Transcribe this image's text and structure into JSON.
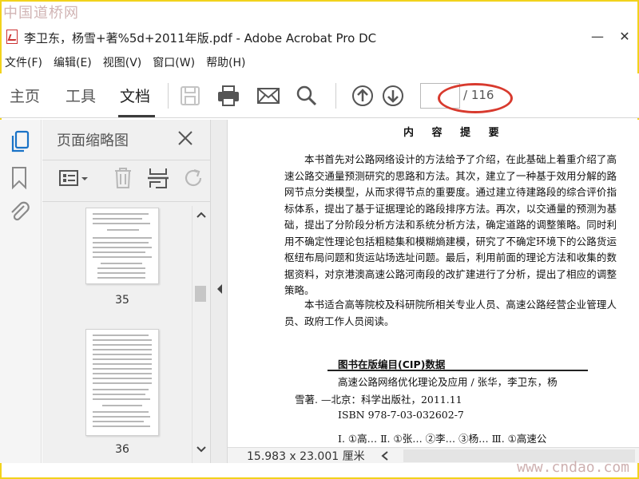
{
  "watermarks": {
    "top": "中国道桥网",
    "bottom": "www.cndao.com"
  },
  "window": {
    "title": "李卫东，杨雪+著%5d+2011年版.pdf - Adobe Acrobat Pro DC",
    "minimize": "—",
    "close": "✕"
  },
  "menu": [
    "文件(F)",
    "编辑(E)",
    "视图(V)",
    "窗口(W)",
    "帮助(H)"
  ],
  "toolbar": {
    "tabs": [
      "主页",
      "工具",
      "文档"
    ],
    "active_tab": "文档",
    "page_current": "",
    "page_total": "/ 116",
    "icons": [
      "save-icon",
      "print-icon",
      "email-icon",
      "search-icon",
      "page-up-icon",
      "page-down-icon"
    ]
  },
  "rail_icons": [
    "page-thumbnails-icon",
    "bookmark-icon",
    "attachment-icon"
  ],
  "thumbnail_panel": {
    "title": "页面缩略图",
    "pages": [
      {
        "number": "35"
      },
      {
        "number": "36"
      }
    ]
  },
  "document": {
    "heading": "内 容 提 要",
    "paragraphs": [
      "本书首先对公路网络设计的方法给予了介绍，在此基础上着重介绍了高速公路交通量预测研究的思路和方法。其次，建立了一种基于效用分解的路网节点分类模型，从而求得节点的重要度。通过建立待建路段的综合评价指标体系，提出了基于证据理论的路段排序方法。再次，以交通量的预测为基础，提出了分阶段分析方法和系统分析方法，确定道路的调整策略。同时利用不确定性理论包括粗糙集和模糊熵建模，研究了不确定环境下的公路货运枢纽布局问题和货运站场选址问题。最后，利用前面的理论方法和收集的数据资料，对京港澳高速公路河南段的改扩建进行了分析，提出了相应的调整策略。",
      "本书适合高等院校及科研院所相关专业人员、高速公路经营企业管理人员、政府工作人员阅读。"
    ],
    "cip_title": "图书在版编目(CIP)数据",
    "cip_lines": [
      "高速公路网络优化理论及应用 / 张华，李卫东，杨",
      "雪著. —北京：科学出版社，2011.11",
      "ISBN 978-7-03-032602-7",
      "Ⅰ. ①高…   Ⅱ. ①张…   ②李…   ③杨…   Ⅲ. ①高速公"
    ]
  },
  "status": {
    "page_size": "15.983 x 23.001 厘米"
  },
  "colors": {
    "highlight_ellipse": "#d83a2e",
    "frame": "#f2d21c"
  }
}
